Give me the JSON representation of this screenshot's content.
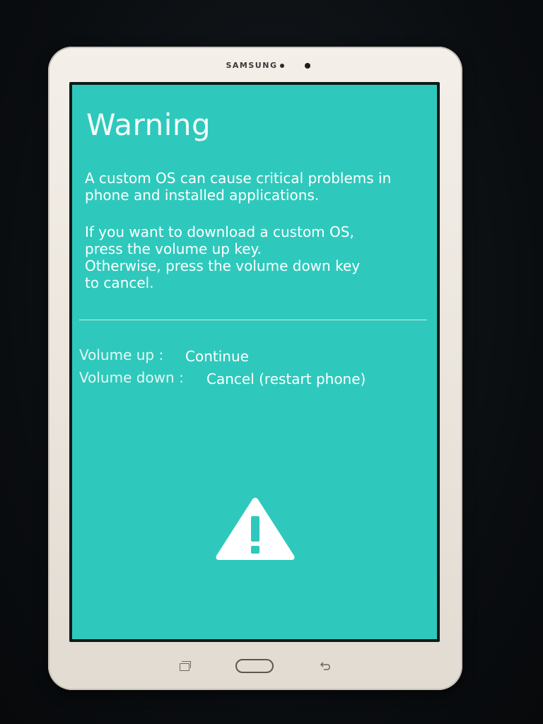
{
  "device": {
    "brand": "SAMSUNG"
  },
  "screen": {
    "background_color": "#2ec9bc",
    "title": "Warning",
    "message_1": "A custom OS can cause critical problems in phone and installed applications.",
    "message_2_line1": "If you want to download a custom OS,",
    "message_2_line2": "press the volume up key.",
    "message_2_line3": "Otherwise, press the volume down key",
    "message_2_line4": "to cancel.",
    "options": [
      {
        "key": "Volume up :",
        "action": "Continue"
      },
      {
        "key": "Volume down :",
        "action": "Cancel (restart phone)"
      }
    ],
    "icon": "warning-triangle-icon"
  },
  "hardware_keys": {
    "left": "recent-apps-icon",
    "center": "home-button",
    "right": "back-icon"
  }
}
